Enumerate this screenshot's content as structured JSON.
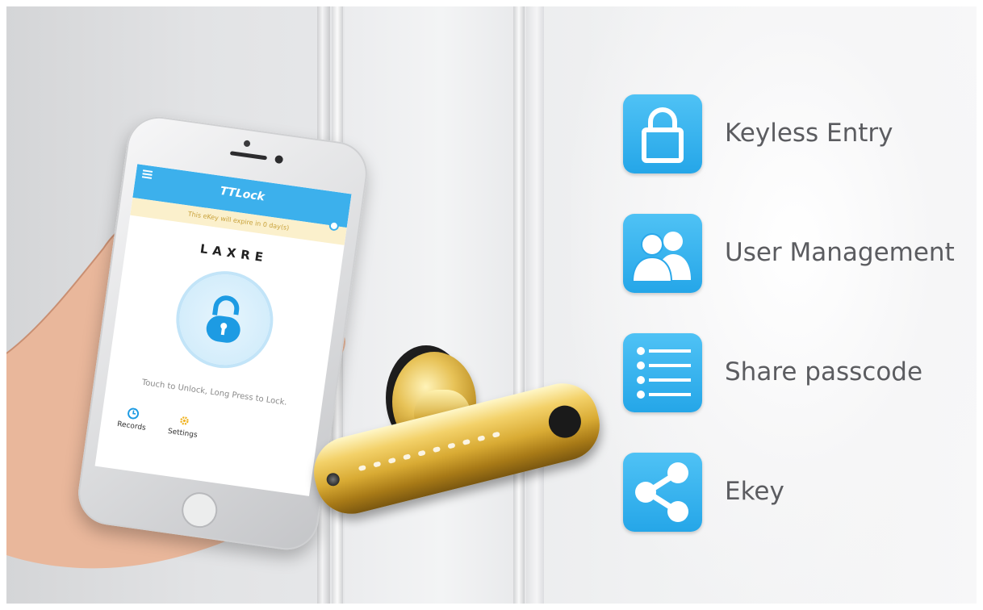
{
  "phone": {
    "app_title": "TTLock",
    "notice": "This eKey will expire in 0 day(s)",
    "brand": "LAXRE",
    "hint": "Touch to Unlock, Long Press to Lock.",
    "tabs": [
      {
        "label": "Records",
        "icon": "clock-icon"
      },
      {
        "label": "Settings",
        "icon": "gear-icon"
      }
    ]
  },
  "features": [
    {
      "label": "Keyless Entry",
      "icon": "padlock-icon"
    },
    {
      "label": "User Management",
      "icon": "users-icon"
    },
    {
      "label": "Share passcode",
      "icon": "list-icon"
    },
    {
      "label": "Ekey",
      "icon": "share-icon"
    }
  ],
  "colors": {
    "accent": "#29A8EA",
    "label_text": "#5B5C60",
    "notice_bg": "#FBF0CC"
  }
}
